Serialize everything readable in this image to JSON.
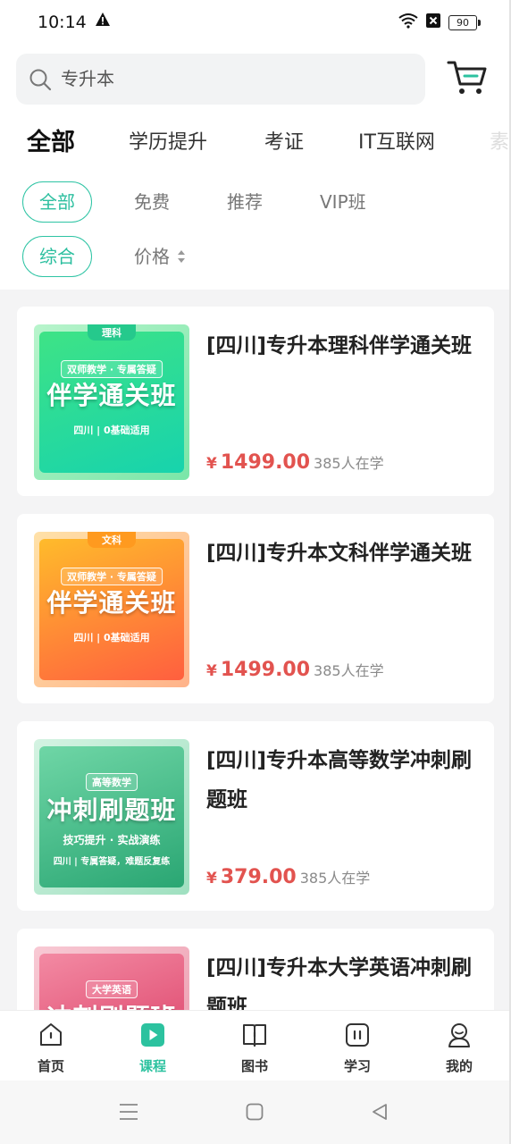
{
  "status_bar": {
    "time": "10:14",
    "battery": "90"
  },
  "search": {
    "placeholder": "专升本"
  },
  "category_tabs": [
    "全部",
    "学历提升",
    "考证",
    "IT互联网",
    "素"
  ],
  "filters": {
    "row1": [
      "全部",
      "免费",
      "推荐",
      "VIP班"
    ],
    "row2": [
      "综合",
      "价格"
    ]
  },
  "courses": [
    {
      "title": "[四川]专升本理科伴学通关班",
      "price": "1499.00",
      "currency": "¥",
      "students": "385人在学",
      "thumb": {
        "tag": "理科",
        "sub": "双师教学 · 专属答疑",
        "big": "伴学通关班",
        "foot": "四川 | 0基础适用",
        "color1": "#34e08f",
        "color2": "#1fd3a6"
      }
    },
    {
      "title": "[四川]专升本文科伴学通关班",
      "price": "1499.00",
      "currency": "¥",
      "students": "385人在学",
      "thumb": {
        "tag": "文科",
        "sub": "双师教学 · 专属答疑",
        "big": "伴学通关班",
        "foot": "四川 | 0基础适用",
        "color1": "#ffb232",
        "color2": "#ff6a3d"
      }
    },
    {
      "title": "[四川]专升本高等数学冲刺刷题班",
      "price": "379.00",
      "currency": "¥",
      "students": "385人在学",
      "thumb": {
        "sub": "高等数学",
        "big": "冲刺刷题班",
        "foot": "技巧提升 · 实战演练",
        "foot2": "四川 | 专属答疑，难题反复练",
        "color1": "#5bcf9c",
        "color2": "#2eaa78"
      }
    },
    {
      "title": "[四川]专升本大学英语冲刺刷题班",
      "price": "",
      "currency": "",
      "students": "",
      "thumb": {
        "sub": "大学英语",
        "big": "冲刺刷题班",
        "color1": "#f07a96",
        "color2": "#d8365f"
      }
    }
  ],
  "tab_bar": [
    {
      "label": "首页",
      "icon": "home-icon"
    },
    {
      "label": "课程",
      "icon": "play-icon",
      "active": true
    },
    {
      "label": "图书",
      "icon": "book-icon"
    },
    {
      "label": "学习",
      "icon": "study-icon"
    },
    {
      "label": "我的",
      "icon": "user-icon"
    }
  ],
  "accent_color": "#2cc29f",
  "price_color": "#e2534f"
}
